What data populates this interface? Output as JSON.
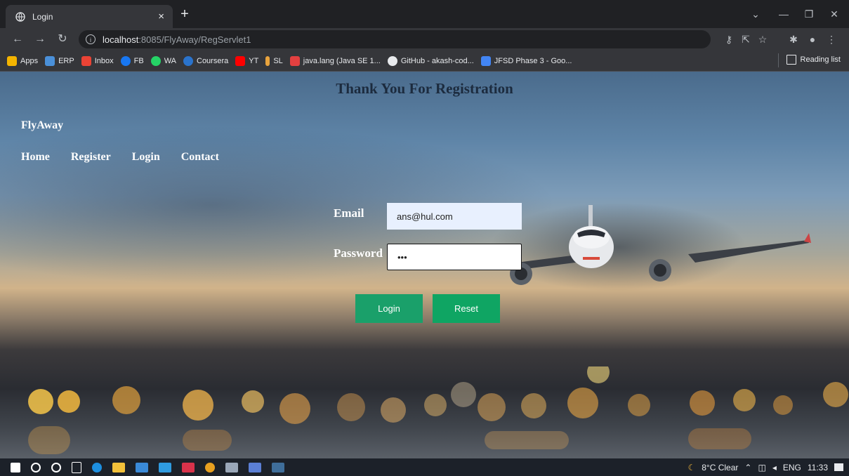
{
  "browser": {
    "tab_title": "Login",
    "tab_close": "×",
    "new_tab": "+",
    "url_host": "localhost",
    "url_rest": ":8085/FlyAway/RegServlet1",
    "bookmarks": [
      {
        "label": "Apps",
        "color": "#f4b400"
      },
      {
        "label": "ERP",
        "color": "#4a90d9"
      },
      {
        "label": "Inbox",
        "color": "#ea4335"
      },
      {
        "label": "FB",
        "color": "#1877f2"
      },
      {
        "label": "WA",
        "color": "#25d366"
      },
      {
        "label": "Coursera",
        "color": "#2a73cc"
      },
      {
        "label": "YT",
        "color": "#ff0000"
      },
      {
        "label": "SL",
        "color": "#e8a33d"
      },
      {
        "label": "java.lang (Java SE 1...",
        "color": "#e34040"
      },
      {
        "label": "GitHub - akash-cod...",
        "color": "#e8eaed"
      },
      {
        "label": "JFSD Phase 3 - Goo...",
        "color": "#4285f4"
      }
    ],
    "reading_list": "Reading list"
  },
  "page": {
    "heading": "Thank You For Registration",
    "logo": "FlyAway",
    "nav": [
      "Home",
      "Register",
      "Login",
      "Contact"
    ],
    "form": {
      "email_label": "Email",
      "email_value": "ans@hul.com",
      "password_label": "Password",
      "password_value": "•••",
      "login_button": "Login",
      "reset_button": "Reset"
    }
  },
  "taskbar": {
    "weather": "8°C  Clear",
    "language": "ENG",
    "time": "11:33"
  },
  "colors": {
    "button_green": "#1aa06a",
    "heading_navy": "#1c2b3e"
  }
}
